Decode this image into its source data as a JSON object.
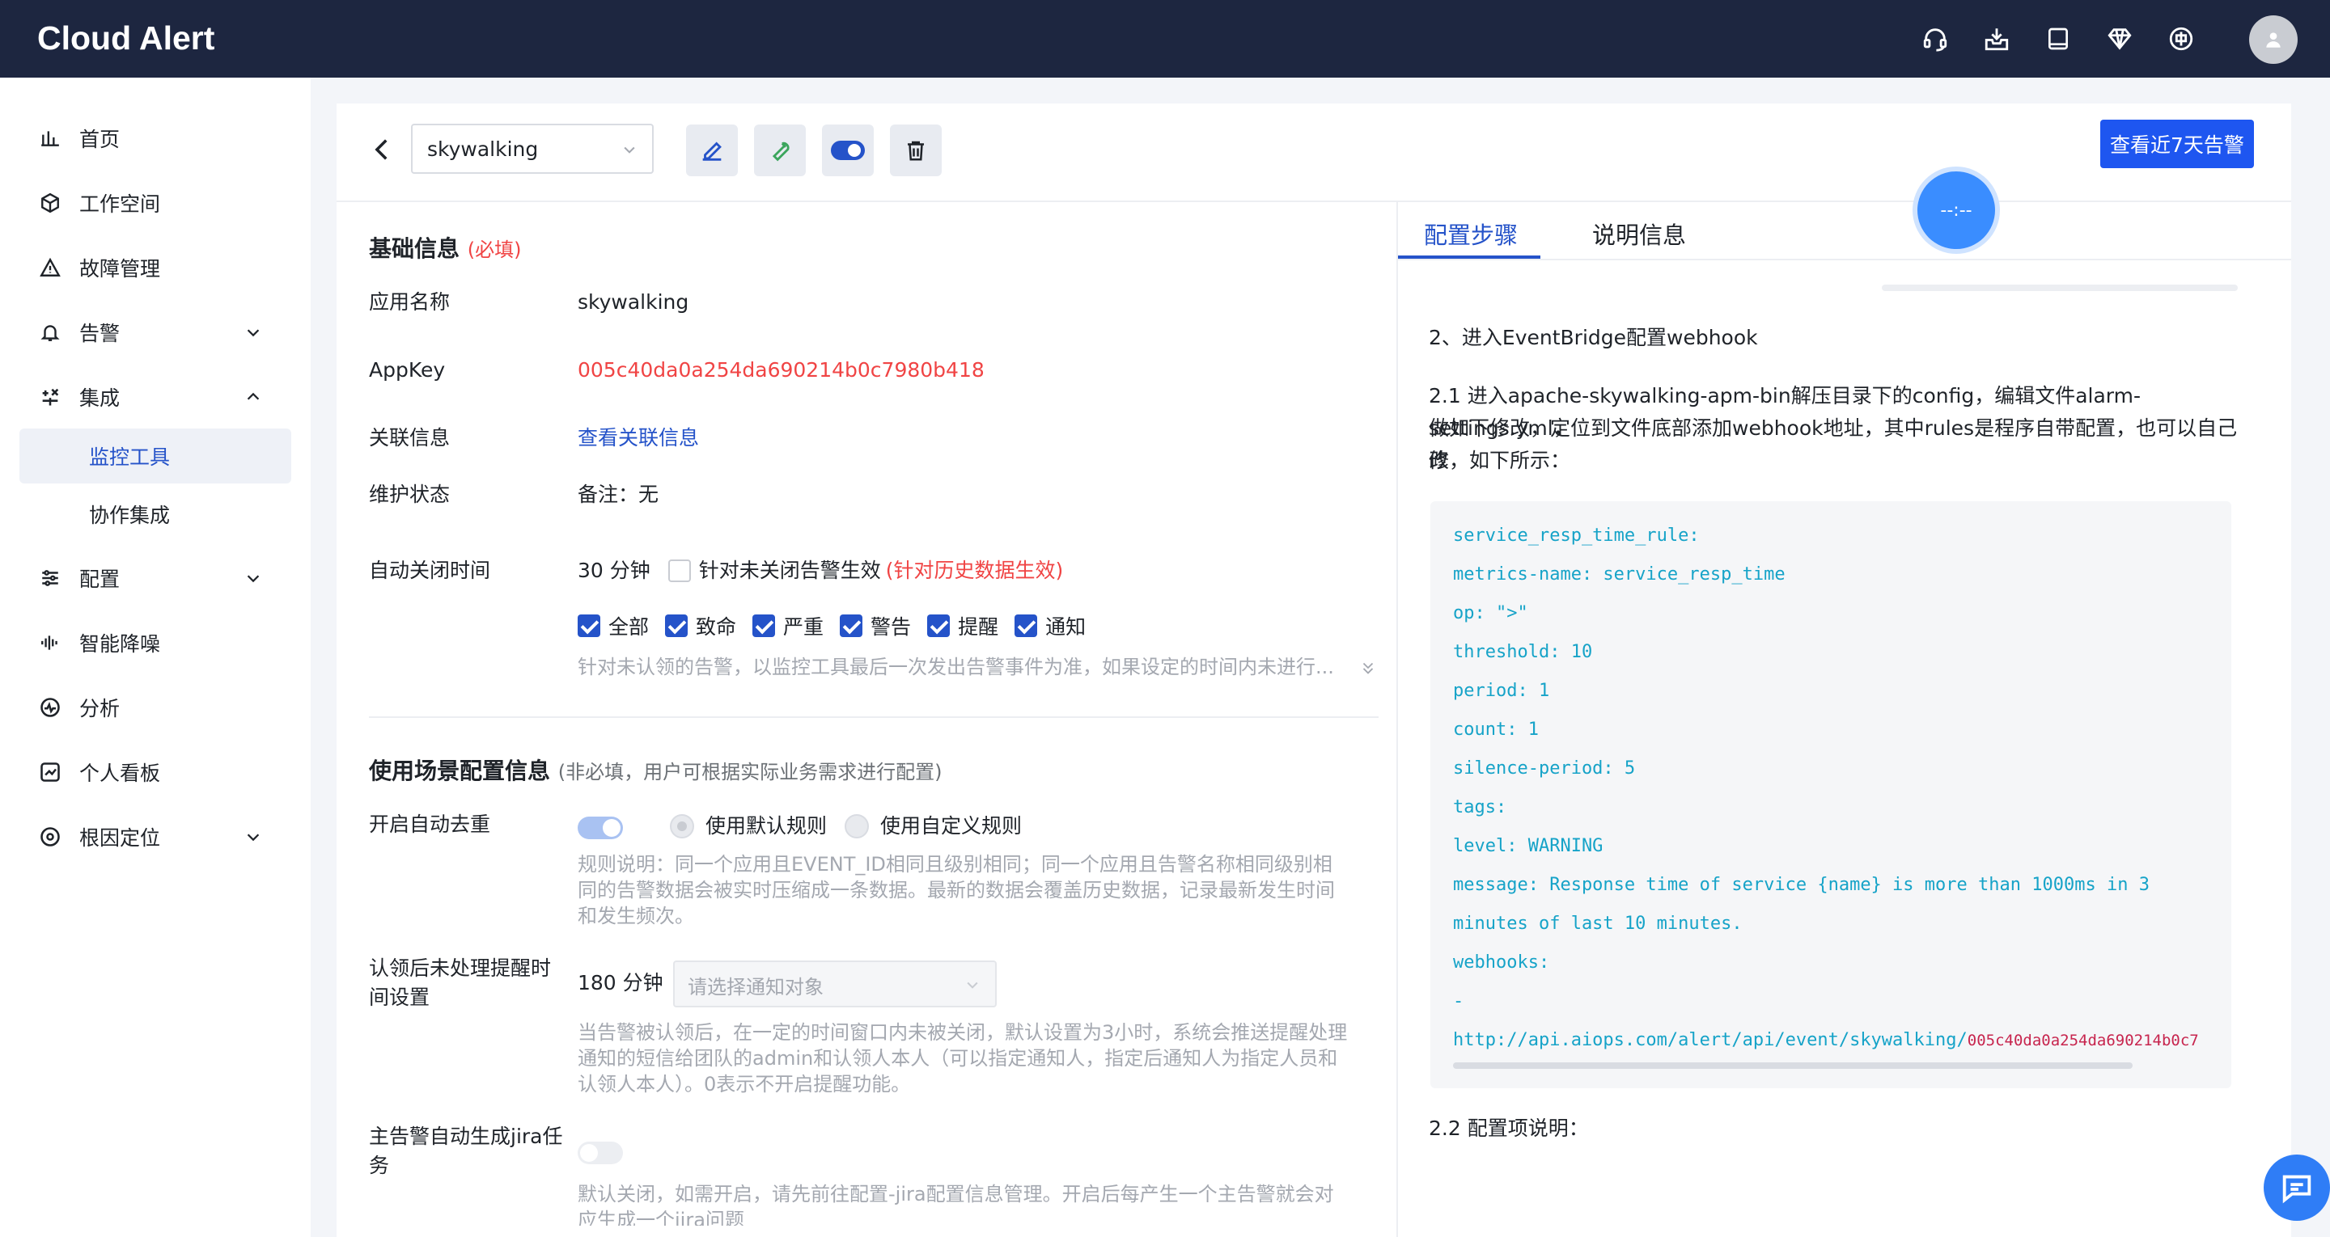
{
  "app": {
    "title": "Cloud Alert"
  },
  "topbar": {
    "icons": [
      "headset-icon",
      "inbox-download-icon",
      "book-icon",
      "diamond-icon",
      "language-zh-icon"
    ],
    "avatar_icon": "user-icon"
  },
  "sidebar": {
    "items": [
      {
        "label": "首页",
        "icon": "bar-chart-icon"
      },
      {
        "label": "工作空间",
        "icon": "cube-icon"
      },
      {
        "label": "故障管理",
        "icon": "warning-triangle-icon"
      },
      {
        "label": "告警",
        "icon": "bell-icon",
        "chevron": "down"
      },
      {
        "label": "集成",
        "icon": "integration-icon",
        "chevron": "up"
      },
      {
        "label": "配置",
        "icon": "sliders-icon",
        "chevron": "down"
      },
      {
        "label": "智能降噪",
        "icon": "waveform-icon"
      },
      {
        "label": "分析",
        "icon": "pulse-circle-icon"
      },
      {
        "label": "个人看板",
        "icon": "line-chart-icon"
      },
      {
        "label": "根因定位",
        "icon": "target-icon",
        "chevron": "down"
      }
    ],
    "subitems": [
      {
        "label": "监控工具",
        "active": true
      },
      {
        "label": "协作集成",
        "active": false
      }
    ]
  },
  "header": {
    "tool_select_value": "skywalking",
    "tool_buttons": [
      "edit-icon",
      "wrench-icon",
      "toggle-icon",
      "trash-icon"
    ],
    "primary_button": "查看近7天告警"
  },
  "basic": {
    "title": "基础信息",
    "required": "(必填)",
    "app_name_label": "应用名称",
    "app_name": "skywalking",
    "appkey_label": "AppKey",
    "appkey": "005c40da0a254da690214b0c7980b418",
    "assoc_label": "关联信息",
    "assoc_link": "查看关联信息",
    "maint_label": "维护状态",
    "maint_value": "备注：无",
    "autoclose_label": "自动关闭时间",
    "autoclose_value": "30 分钟",
    "autoclose_check": "针对未关闭告警生效",
    "autoclose_note": "(针对历史数据生效)",
    "levels": [
      "全部",
      "致命",
      "严重",
      "警告",
      "提醒",
      "通知"
    ],
    "autoclose_help": "针对未认领的告警，以监控工具最后一次发出告警事件为准，如果设定的时间内未进行..."
  },
  "scene": {
    "title": "使用场景配置信息",
    "subtitle": "(非必填，用户可根据实际业务需求进行配置)",
    "dedup_label": "开启自动去重",
    "dedup_enabled": true,
    "radio_default": "使用默认规则",
    "radio_custom": "使用自定义规则",
    "dedup_help": [
      "规则说明：同一个应用且EVENT_ID相同且级别相同；同一个应用且告警名称相同级别相",
      "同的告警数据会被实时压缩成一条数据。最新的数据会覆盖历史数据，记录最新发生时间",
      "和发生频次。"
    ],
    "remind_label_1": "认领后未处理提醒时",
    "remind_label_2": "间设置",
    "remind_value": "180 分钟",
    "remind_placeholder": "请选择通知对象",
    "remind_help": [
      "当告警被认领后，在一定的时间窗口内未被关闭，默认设置为3小时，系统会推送提醒处理",
      "通知的短信给团队的admin和认领人本人（可以指定通知人，指定后通知人为指定人员和",
      "认领人本人）。0表示不开启提醒功能。"
    ],
    "jira_label_1": "主告警自动生成jira任",
    "jira_label_2": "务",
    "jira_enabled": false,
    "jira_help": [
      "默认关闭，如需开启，请先前往配置-jira配置信息管理。开启后每产生一个主告警就会对",
      "应生成一个jira问题"
    ]
  },
  "right": {
    "tabs": [
      "配置步骤",
      "说明信息"
    ],
    "active_tab": 0,
    "float_text": "--:--",
    "step2": "2、进入EventBridge配置webhook",
    "step21": [
      "2.1 进入apache-skywalking-apm-bin解压目录下的config，编辑文件alarm-settings.yml，",
      "做如下修改，定位到文件底部添加webhook地址，其中rules是程序自带配置，也可以自己修",
      "改，如下所示："
    ],
    "code": [
      "service_resp_time_rule:",
      "metrics-name: service_resp_time",
      "op: \">\"",
      "threshold: 10",
      "period: 1",
      "count: 1",
      "silence-period: 5",
      "tags:",
      "level: WARNING",
      "message: Response time of service {name} is more than 1000ms in 3",
      "minutes of last 10 minutes.",
      "webhooks:",
      "-"
    ],
    "code_url": "http://api.aiops.com/alert/api/event/skywalking/",
    "code_key": "005c40da0a254da690214b0c7",
    "step22": "2.2 配置项说明："
  },
  "colors": {
    "topbar": "#1d2640",
    "accent": "#2553c9",
    "primary": "#1e56f0",
    "danger": "#f04444",
    "code": "#16a3c8"
  }
}
